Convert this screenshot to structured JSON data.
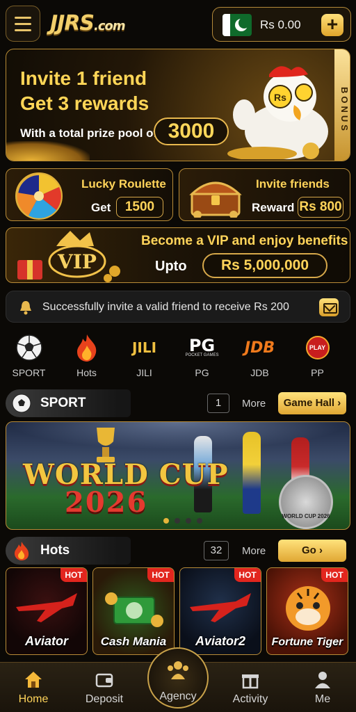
{
  "header": {
    "logo_main": "JJRS",
    "logo_suffix": ".com",
    "balance": "Rs 0.00",
    "add_label": "+"
  },
  "invite_banner": {
    "line1": "Invite 1 friend",
    "line2": "Get 3 rewards",
    "pool_label": "With a total prize pool of",
    "pool_value": "3000",
    "side_tab": "BONUS",
    "chicken_badge": "Rs"
  },
  "cards": {
    "roulette": {
      "title": "Lucky Roulette",
      "label": "Get",
      "value": "1500"
    },
    "invite": {
      "title": "Invite friends",
      "label": "Reward",
      "value": "Rs 800"
    }
  },
  "vip_banner": {
    "badge": "VIP",
    "title": "Become a VIP and enjoy benefits",
    "upto_label": "Upto",
    "value": "Rs 5,000,000"
  },
  "notice": {
    "text": "Successfully invite a valid friend to receive Rs 200"
  },
  "categories": [
    {
      "label": "SPORT",
      "icon": "soccer-ball-icon"
    },
    {
      "label": "Hots",
      "icon": "flame-icon"
    },
    {
      "label": "JILI",
      "icon": "jili-logo",
      "logo_text": "JILI"
    },
    {
      "label": "PG",
      "icon": "pg-logo",
      "logo_text": "PG",
      "logo_sub": "POCKET GAMES"
    },
    {
      "label": "JDB",
      "icon": "jdb-logo",
      "logo_text": "JDB"
    },
    {
      "label": "PP",
      "icon": "play-logo",
      "logo_text": "PLAY"
    }
  ],
  "sport_section": {
    "title": "SPORT",
    "count": "1",
    "more": "More",
    "button": "Game Hall",
    "banner": {
      "title_line1": "WORLD CUP",
      "title_line2": "2026",
      "coin_text": "WORLD CUP 2026",
      "slides": 4,
      "active_slide": 1
    }
  },
  "hots_section": {
    "title": "Hots",
    "count": "32",
    "more": "More",
    "button": "Go",
    "games": [
      {
        "name": "Aviator",
        "badge": "HOT"
      },
      {
        "name": "Cash Mania",
        "badge": "HOT"
      },
      {
        "name": "Aviator2",
        "badge": "HOT"
      },
      {
        "name": "Fortune Tiger",
        "badge": "HOT"
      }
    ]
  },
  "bottom_nav": [
    {
      "label": "Home",
      "icon": "home-icon",
      "active": true
    },
    {
      "label": "Deposit",
      "icon": "wallet-icon",
      "active": false
    },
    {
      "label": "Agency",
      "icon": "agency-icon",
      "active": false
    },
    {
      "label": "Activity",
      "icon": "gift-icon",
      "active": false
    },
    {
      "label": "Me",
      "icon": "user-icon",
      "active": false
    }
  ],
  "colors": {
    "gold": "#ffd45a",
    "gold_border": "#b98c38",
    "background": "#0b0906",
    "hot_badge": "#e2261e"
  }
}
